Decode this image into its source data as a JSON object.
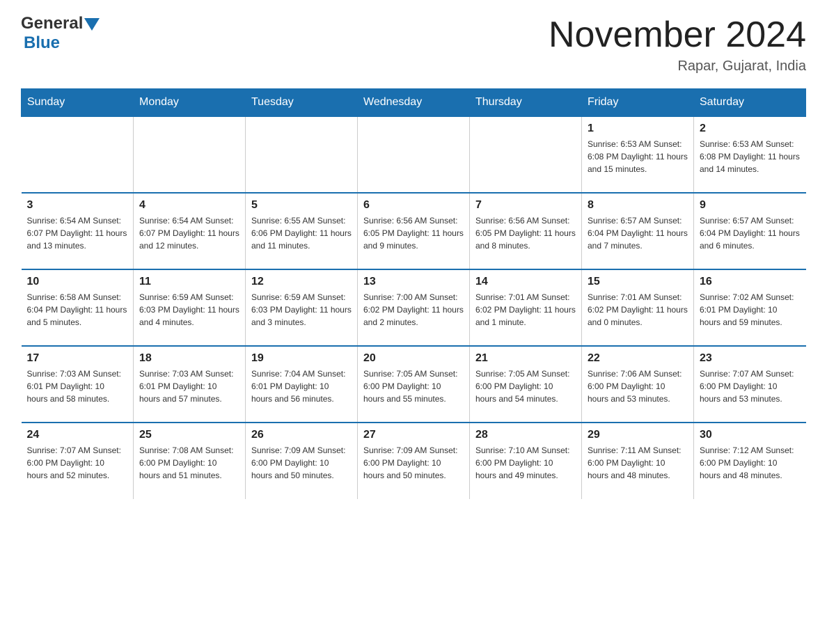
{
  "header": {
    "logo_general": "General",
    "logo_blue": "Blue",
    "month_title": "November 2024",
    "location": "Rapar, Gujarat, India"
  },
  "weekdays": [
    "Sunday",
    "Monday",
    "Tuesday",
    "Wednesday",
    "Thursday",
    "Friday",
    "Saturday"
  ],
  "rows": [
    [
      {
        "day": "",
        "info": ""
      },
      {
        "day": "",
        "info": ""
      },
      {
        "day": "",
        "info": ""
      },
      {
        "day": "",
        "info": ""
      },
      {
        "day": "",
        "info": ""
      },
      {
        "day": "1",
        "info": "Sunrise: 6:53 AM\nSunset: 6:08 PM\nDaylight: 11 hours and 15 minutes."
      },
      {
        "day": "2",
        "info": "Sunrise: 6:53 AM\nSunset: 6:08 PM\nDaylight: 11 hours and 14 minutes."
      }
    ],
    [
      {
        "day": "3",
        "info": "Sunrise: 6:54 AM\nSunset: 6:07 PM\nDaylight: 11 hours and 13 minutes."
      },
      {
        "day": "4",
        "info": "Sunrise: 6:54 AM\nSunset: 6:07 PM\nDaylight: 11 hours and 12 minutes."
      },
      {
        "day": "5",
        "info": "Sunrise: 6:55 AM\nSunset: 6:06 PM\nDaylight: 11 hours and 11 minutes."
      },
      {
        "day": "6",
        "info": "Sunrise: 6:56 AM\nSunset: 6:05 PM\nDaylight: 11 hours and 9 minutes."
      },
      {
        "day": "7",
        "info": "Sunrise: 6:56 AM\nSunset: 6:05 PM\nDaylight: 11 hours and 8 minutes."
      },
      {
        "day": "8",
        "info": "Sunrise: 6:57 AM\nSunset: 6:04 PM\nDaylight: 11 hours and 7 minutes."
      },
      {
        "day": "9",
        "info": "Sunrise: 6:57 AM\nSunset: 6:04 PM\nDaylight: 11 hours and 6 minutes."
      }
    ],
    [
      {
        "day": "10",
        "info": "Sunrise: 6:58 AM\nSunset: 6:04 PM\nDaylight: 11 hours and 5 minutes."
      },
      {
        "day": "11",
        "info": "Sunrise: 6:59 AM\nSunset: 6:03 PM\nDaylight: 11 hours and 4 minutes."
      },
      {
        "day": "12",
        "info": "Sunrise: 6:59 AM\nSunset: 6:03 PM\nDaylight: 11 hours and 3 minutes."
      },
      {
        "day": "13",
        "info": "Sunrise: 7:00 AM\nSunset: 6:02 PM\nDaylight: 11 hours and 2 minutes."
      },
      {
        "day": "14",
        "info": "Sunrise: 7:01 AM\nSunset: 6:02 PM\nDaylight: 11 hours and 1 minute."
      },
      {
        "day": "15",
        "info": "Sunrise: 7:01 AM\nSunset: 6:02 PM\nDaylight: 11 hours and 0 minutes."
      },
      {
        "day": "16",
        "info": "Sunrise: 7:02 AM\nSunset: 6:01 PM\nDaylight: 10 hours and 59 minutes."
      }
    ],
    [
      {
        "day": "17",
        "info": "Sunrise: 7:03 AM\nSunset: 6:01 PM\nDaylight: 10 hours and 58 minutes."
      },
      {
        "day": "18",
        "info": "Sunrise: 7:03 AM\nSunset: 6:01 PM\nDaylight: 10 hours and 57 minutes."
      },
      {
        "day": "19",
        "info": "Sunrise: 7:04 AM\nSunset: 6:01 PM\nDaylight: 10 hours and 56 minutes."
      },
      {
        "day": "20",
        "info": "Sunrise: 7:05 AM\nSunset: 6:00 PM\nDaylight: 10 hours and 55 minutes."
      },
      {
        "day": "21",
        "info": "Sunrise: 7:05 AM\nSunset: 6:00 PM\nDaylight: 10 hours and 54 minutes."
      },
      {
        "day": "22",
        "info": "Sunrise: 7:06 AM\nSunset: 6:00 PM\nDaylight: 10 hours and 53 minutes."
      },
      {
        "day": "23",
        "info": "Sunrise: 7:07 AM\nSunset: 6:00 PM\nDaylight: 10 hours and 53 minutes."
      }
    ],
    [
      {
        "day": "24",
        "info": "Sunrise: 7:07 AM\nSunset: 6:00 PM\nDaylight: 10 hours and 52 minutes."
      },
      {
        "day": "25",
        "info": "Sunrise: 7:08 AM\nSunset: 6:00 PM\nDaylight: 10 hours and 51 minutes."
      },
      {
        "day": "26",
        "info": "Sunrise: 7:09 AM\nSunset: 6:00 PM\nDaylight: 10 hours and 50 minutes."
      },
      {
        "day": "27",
        "info": "Sunrise: 7:09 AM\nSunset: 6:00 PM\nDaylight: 10 hours and 50 minutes."
      },
      {
        "day": "28",
        "info": "Sunrise: 7:10 AM\nSunset: 6:00 PM\nDaylight: 10 hours and 49 minutes."
      },
      {
        "day": "29",
        "info": "Sunrise: 7:11 AM\nSunset: 6:00 PM\nDaylight: 10 hours and 48 minutes."
      },
      {
        "day": "30",
        "info": "Sunrise: 7:12 AM\nSunset: 6:00 PM\nDaylight: 10 hours and 48 minutes."
      }
    ]
  ]
}
